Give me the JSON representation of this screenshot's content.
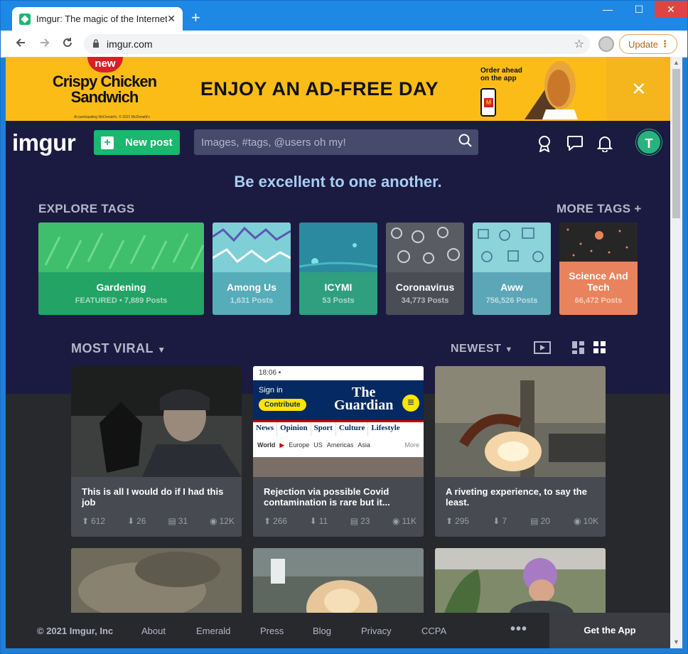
{
  "browser": {
    "tab_title": "Imgur: The magic of the Internet",
    "tab_close": "✕",
    "new_tab": "+",
    "url": "imgur.com",
    "update_label": "Update",
    "min": "—",
    "max": "☐",
    "close": "✕"
  },
  "ad": {
    "badge": "new",
    "product": "Crispy Chicken Sandwich",
    "fine_print": "At participating McDonald's. © 2021 McDonald's",
    "headline": "ENJOY AN AD-FREE DAY",
    "order_line1": "Order ahead",
    "order_line2": "on the app",
    "close": "✕"
  },
  "header": {
    "logo": "imgur",
    "new_post": "New post",
    "search_placeholder": "Images, #tags, @users oh my!",
    "avatar_letter": "T"
  },
  "tagline": "Be excellent to one another.",
  "explore_label": "EXPLORE TAGS",
  "more_tags_label": "MORE TAGS +",
  "tags": [
    {
      "name": "Gardening",
      "count": "FEATURED • 7,889 Posts"
    },
    {
      "name": "Among Us",
      "count": "1,631 Posts"
    },
    {
      "name": "ICYMI",
      "count": "53 Posts"
    },
    {
      "name": "Coronavirus",
      "count": "34,773 Posts"
    },
    {
      "name": "Aww",
      "count": "756,526 Posts"
    },
    {
      "name": "Science And Tech",
      "count": "66,472 Posts"
    }
  ],
  "feed": {
    "sort_label": "MOST VIRAL",
    "order_label": "NEWEST"
  },
  "cards": [
    {
      "title": "This is all I would do if I had this job",
      "up": "612",
      "down": "26",
      "comments": "31",
      "views": "12K"
    },
    {
      "title": "Rejection via possible Covid contamination is rare but it...",
      "up": "266",
      "down": "11",
      "comments": "23",
      "views": "11K"
    },
    {
      "title": "A riveting experience, to say the least.",
      "up": "295",
      "down": "7",
      "comments": "20",
      "views": "10K"
    }
  ],
  "guardian": {
    "time": "18:06",
    "sign_in": "Sign in",
    "contribute": "Contribute",
    "masthead_1": "The",
    "masthead_2": "Guardian",
    "nav": [
      "News",
      "Opinion",
      "Sport",
      "Culture",
      "Lifestyle"
    ],
    "subnav": [
      "World",
      "Europe",
      "US",
      "Americas",
      "Asia",
      "More"
    ]
  },
  "footer": {
    "copyright": "© 2021 Imgur, Inc",
    "links": [
      "About",
      "Emerald",
      "Press",
      "Blog",
      "Privacy",
      "CCPA"
    ],
    "more": "•••",
    "get_app": "Get the App"
  },
  "colors": {
    "page_bg": "#1b1a40",
    "accent_green": "#1bb76e",
    "tagline": "#a9cdf2",
    "ad_yellow": "#fbbc18"
  }
}
